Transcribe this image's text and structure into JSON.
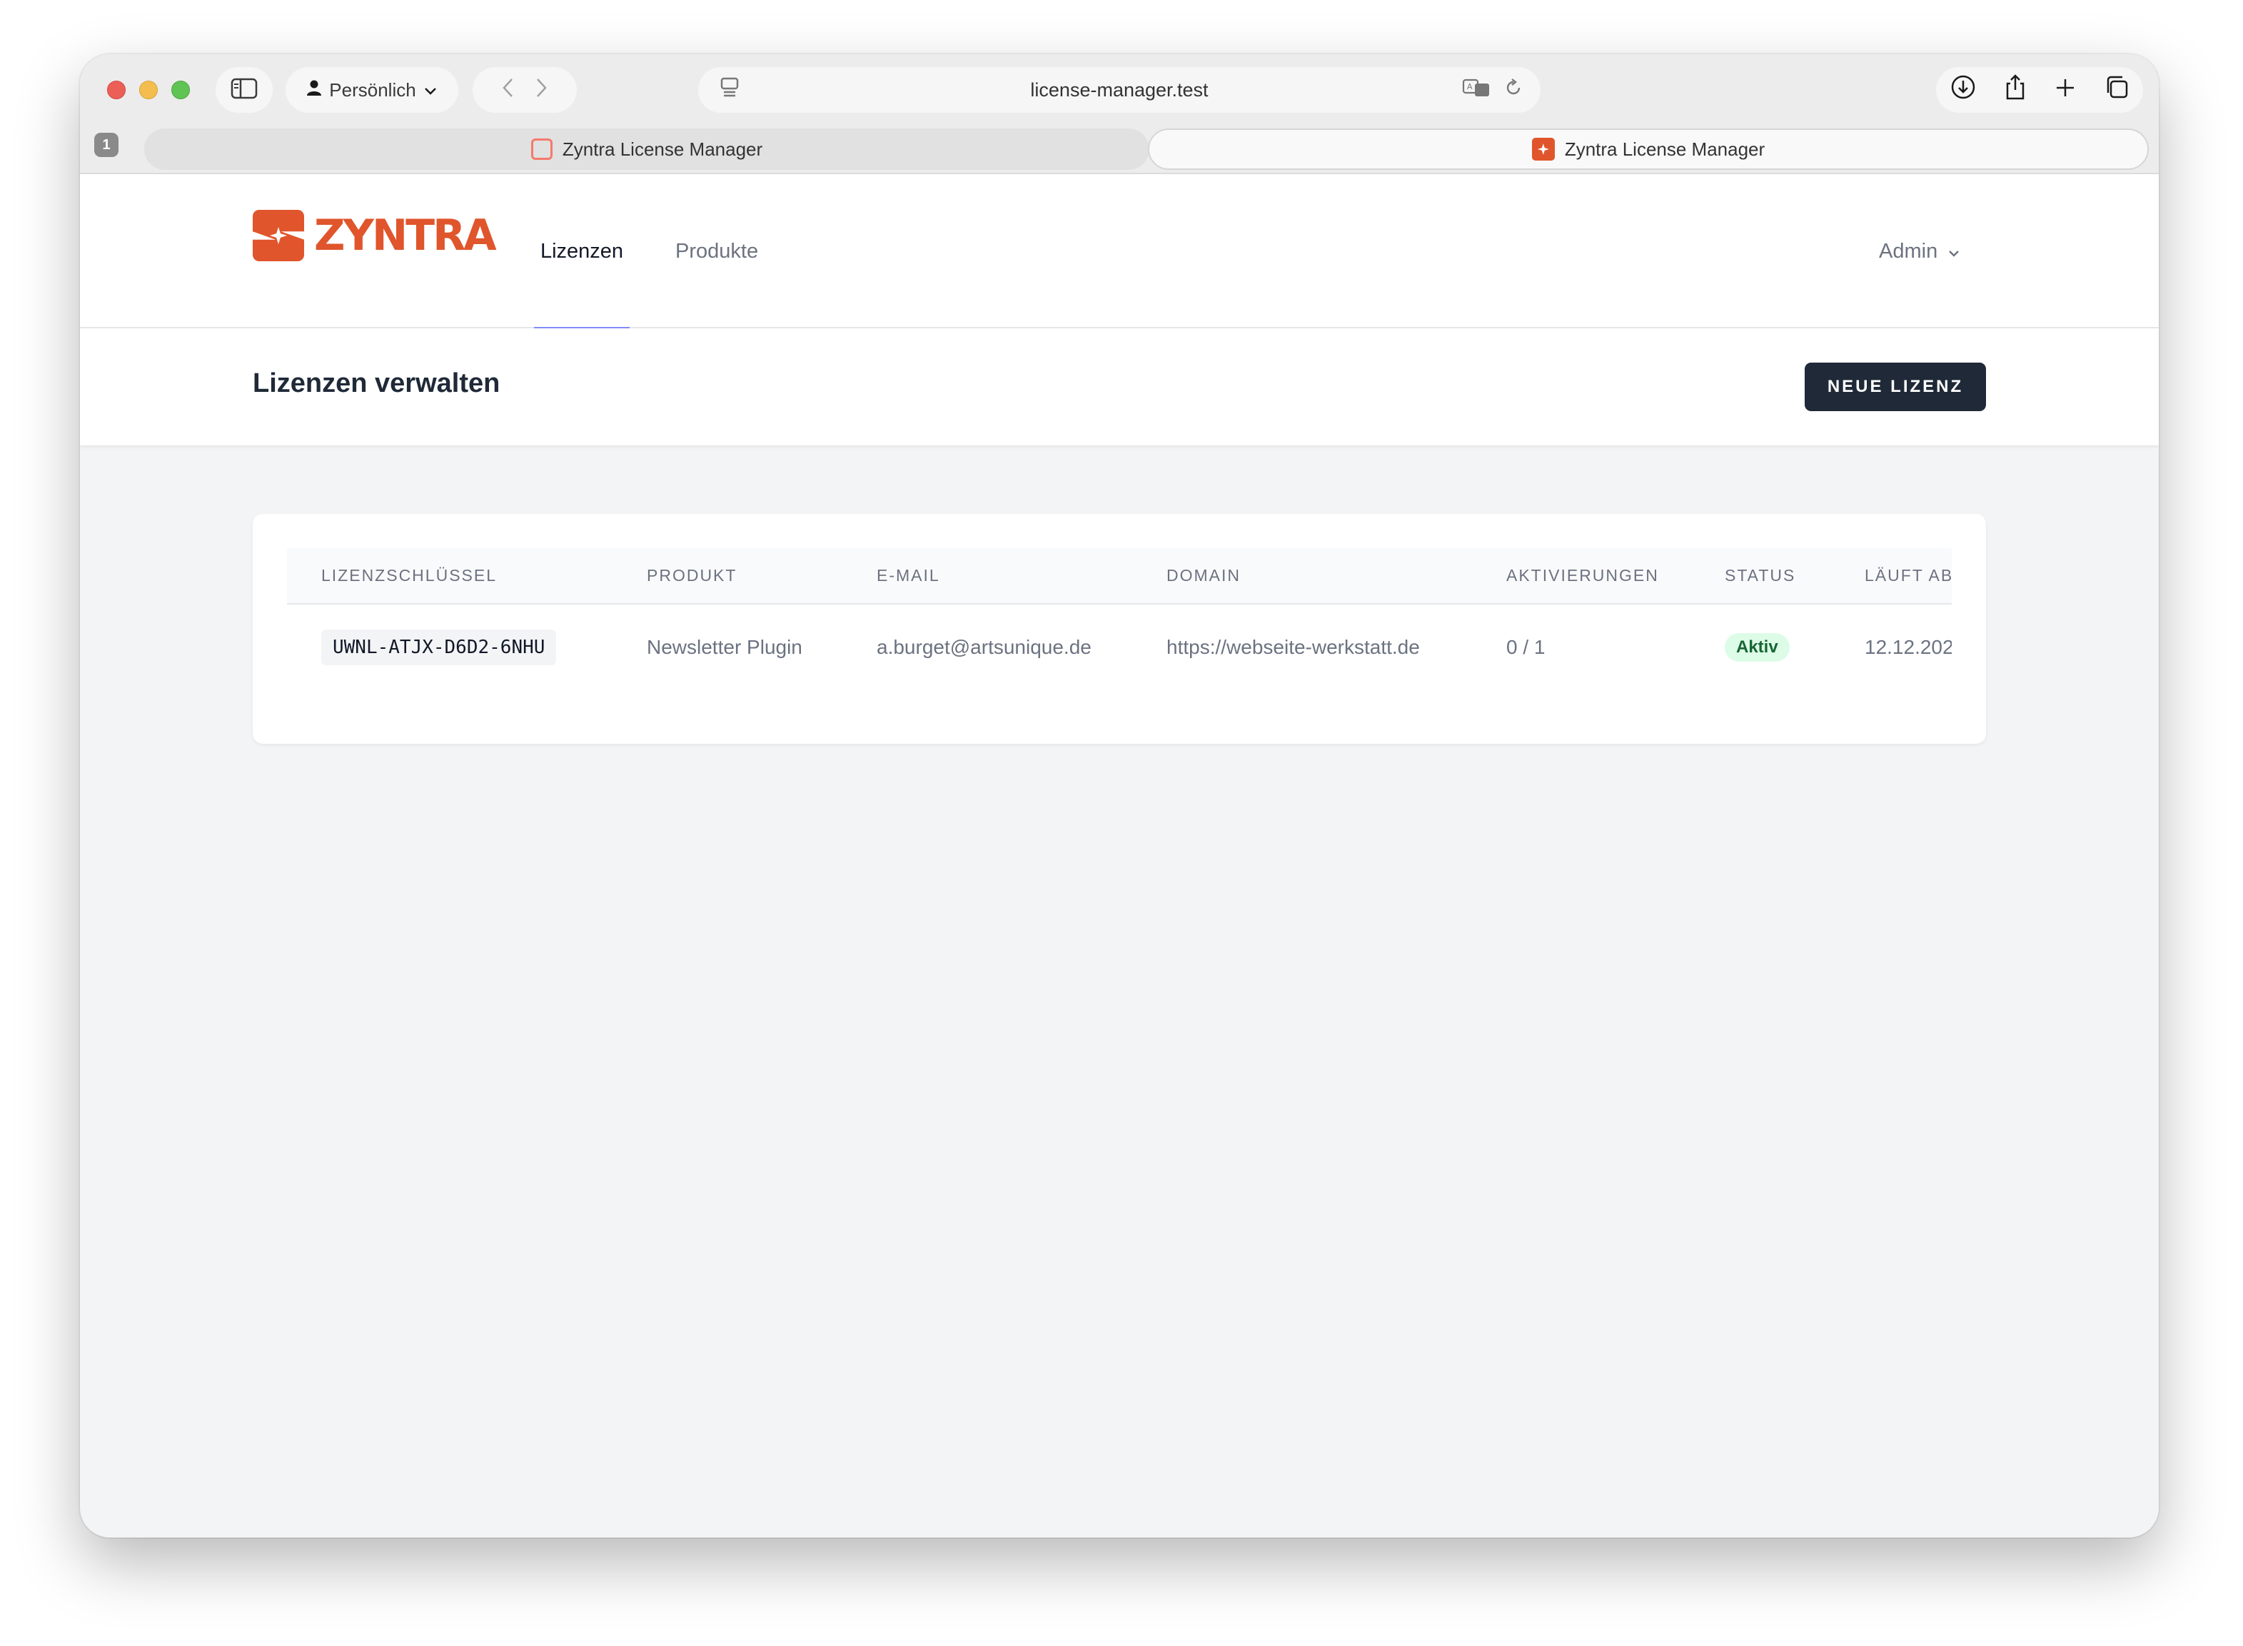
{
  "browser": {
    "profile_label": "Persönlich",
    "address": "license-manager.test",
    "tab_count": "1",
    "tabs": [
      {
        "title": "Zyntra License Manager"
      },
      {
        "title": "Zyntra License Manager"
      }
    ]
  },
  "nav": {
    "brand": "ZYNTRA",
    "links": [
      "Lizenzen",
      "Produkte"
    ],
    "active_link": "Lizenzen",
    "user_menu": "Admin"
  },
  "page": {
    "title": "Lizenzen verwalten",
    "new_button": "NEUE LIZENZ"
  },
  "table": {
    "headers": [
      "LIZENZSCHLÜSSEL",
      "PRODUKT",
      "E-MAIL",
      "DOMAIN",
      "AKTIVIERUNGEN",
      "STATUS",
      "LÄUFT AB"
    ],
    "rows": [
      {
        "key": "UWNL-ATJX-D6D2-6NHU",
        "product": "Newsletter Plugin",
        "email": "a.burget@artsunique.de",
        "domain": "https://webseite-werkstatt.de",
        "activations": "0 / 1",
        "status": "Aktiv",
        "expires": "12.12.202"
      }
    ]
  },
  "colors": {
    "brand": "#e0552b",
    "nav_indicator": "#818cf8",
    "primary_button": "#1f2937",
    "status_active_bg": "#dcfce7",
    "status_active_text": "#166534"
  },
  "icons": {
    "sidebar": "sidebar-icon",
    "profile": "person-icon",
    "back": "chevron-left-icon",
    "forward": "chevron-right-icon",
    "page_menu": "page-menu-icon",
    "translate": "translate-icon",
    "reload": "reload-icon",
    "download": "download-icon",
    "share": "share-icon",
    "new_tab": "plus-icon",
    "tab_overview": "tabs-overview-icon",
    "dropdown": "chevron-down-icon"
  }
}
